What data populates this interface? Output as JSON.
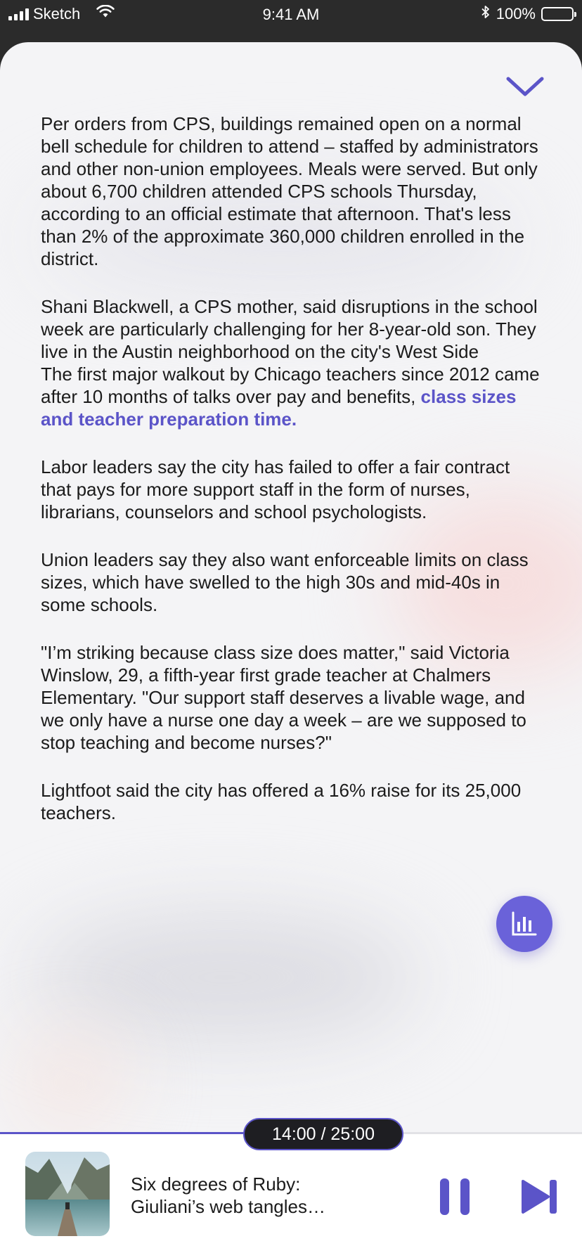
{
  "status_bar": {
    "carrier": "Sketch",
    "time": "9:41 AM",
    "battery_percent": "100%"
  },
  "article": {
    "paragraphs": [
      "Per orders from CPS, buildings remained open on a normal bell schedule for children to attend – staffed by administrators and other non-union employees. Meals were served. But only about 6,700 children attended CPS schools Thursday, according to an official estimate that afternoon. That's less than 2% of the approximate 360,000 children enrolled in the district.",
      "Shani Blackwell, a CPS mother, said disruptions in the school week are particularly challenging for her 8-year-old son. They live in the Austin neighborhood on the city's West Side",
      "The first major walkout by Chicago teachers since 2012 came after 10 months of talks over pay and benefits,",
      "Labor leaders say the city has failed to offer a fair contract that pays for more support staff in the form of nurses, librarians, counselors and school psychologists.",
      "Union leaders say they also want enforceable limits on class sizes, which have swelled to the high 30s and mid-40s in some schools.",
      "\"I’m striking because class size does matter,\" said Victoria Winslow, 29, a fifth-year first grade teacher at Chalmers Elementary. \"Our support staff deserves a livable wage, and we only have a nurse one day a week – are we supposed to stop teaching and become nurses?\"",
      "Lightfoot said the city has offered a 16% raise for its 25,000 teachers."
    ],
    "highlight": "class sizes and teacher preparation time."
  },
  "player": {
    "time_display": "14:00 / 25:00",
    "progress_fraction": 0.56,
    "track_title": "Six degrees of Ruby: Giuliani’s web tangles…"
  },
  "icons": {
    "collapse": "chevron-down-icon",
    "stats": "bar-chart-icon",
    "pause": "pause-icon",
    "next": "skip-next-icon"
  },
  "colors": {
    "accent": "#5b54c8",
    "accent_light": "#6a62d9",
    "pill_bg": "#1e1e22",
    "sheet_bg": "#f4f4f6"
  }
}
